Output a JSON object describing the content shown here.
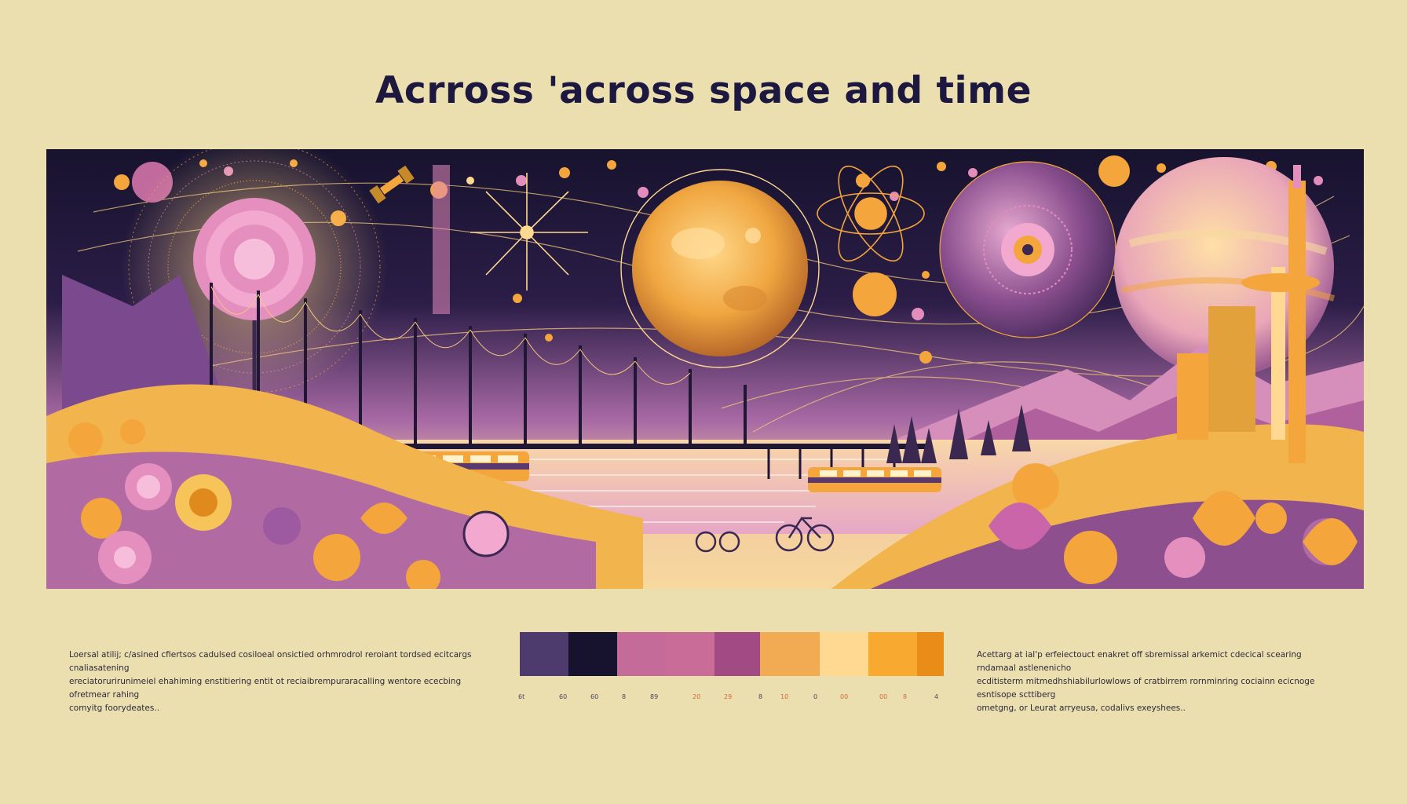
{
  "title": "Acrross 'across space and time",
  "caption_left": [
    "Loersal atilij; c/asined cfiertsos cadulsed cosiloeal onsictied orhmrodrol reroiant tordsed ecitcargs cnaliasatening",
    "ereciatorurirunimeiel ehahiming enstitiering entit ot reciaibrempuraracalling wentore ececbing ofretmear rahing",
    "comyitg foorydeates.."
  ],
  "caption_right": [
    "Acettarg at ial'p erfeiectouct enakret off sbremissal arkemict cdecical scearing rndamaal astlenenicho",
    "ecditisterm mitmedhshiabilurlowlows of cratbirrem rornminring cociainn ecicnoge esntisope scttiberg",
    "ometgng, or Leurat arryeusa, codalivs exeyshees.."
  ],
  "palette": {
    "swatches": [
      {
        "color": "#4e3b6e"
      },
      {
        "color": "#17132f"
      },
      {
        "color": "#c46b9a"
      },
      {
        "color": "#c96d98"
      },
      {
        "color": "#a24a84"
      },
      {
        "color": "#f2ab52"
      },
      {
        "color": "#ffd892"
      },
      {
        "color": "#f7aa2f"
      },
      {
        "color": "#ea8d18"
      }
    ],
    "ticks": [
      "6t",
      "60",
      "60",
      "8",
      "89",
      "20",
      "29",
      "8",
      "10",
      "0",
      "00",
      "00",
      "8",
      "4"
    ]
  },
  "colors": {
    "background": "#ebdfb0",
    "title": "#1c1840",
    "night": "#17132e",
    "orange": "#f4a63c",
    "pink": "#d47ab0",
    "purple": "#7b4a8e"
  }
}
